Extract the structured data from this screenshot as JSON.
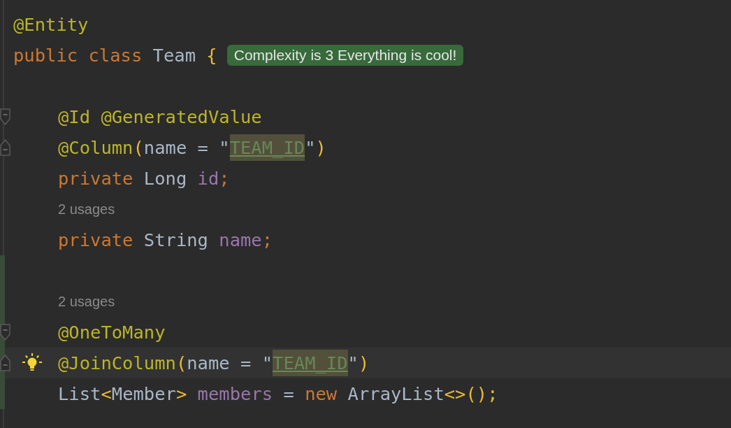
{
  "editor": {
    "lines": [
      {
        "kind": "code",
        "tokens": [
          {
            "kind": "annotation",
            "text": "@Entity"
          }
        ]
      },
      {
        "kind": "code",
        "tokens": [
          {
            "kind": "keyword",
            "text": "public class "
          },
          {
            "kind": "plain",
            "text": "Team "
          },
          {
            "kind": "brace",
            "text": "{"
          }
        ],
        "badge": "Complexity is 3 Everything is cool!",
        "children": [
          {
            "kind": "blank"
          },
          {
            "kind": "code",
            "fold_start": true,
            "tokens": [
              {
                "kind": "annotation",
                "text": "@Id @GeneratedValue"
              }
            ]
          },
          {
            "kind": "code",
            "fold_end": true,
            "tokens": [
              {
                "kind": "annotation",
                "text": "@Column"
              },
              {
                "kind": "brace",
                "text": "("
              },
              {
                "kind": "plain",
                "text": "name = \""
              },
              {
                "kind": "string",
                "text": "TEAM_ID",
                "highlighted": true
              },
              {
                "kind": "plain",
                "text": "\""
              },
              {
                "kind": "brace",
                "text": ")"
              }
            ]
          },
          {
            "kind": "code",
            "tokens": [
              {
                "kind": "keyword",
                "text": "private "
              },
              {
                "kind": "plain",
                "text": "Long "
              },
              {
                "kind": "field",
                "text": "id"
              },
              {
                "kind": "keyword",
                "text": ";"
              }
            ]
          },
          {
            "kind": "hint",
            "text": "2 usages"
          },
          {
            "kind": "code",
            "tokens": [
              {
                "kind": "keyword",
                "text": "private "
              },
              {
                "kind": "plain",
                "text": "String "
              },
              {
                "kind": "field",
                "text": "name"
              },
              {
                "kind": "keyword",
                "text": ";"
              }
            ]
          },
          {
            "kind": "blank",
            "changed": true
          },
          {
            "kind": "hint",
            "text": "2 usages",
            "changed": true
          },
          {
            "kind": "code",
            "fold_start": true,
            "changed": true,
            "tokens": [
              {
                "kind": "annotation",
                "text": "@OneToMany"
              }
            ]
          },
          {
            "kind": "code",
            "fold_end": true,
            "changed": true,
            "current": true,
            "bulb": true,
            "tokens": [
              {
                "kind": "annotation",
                "text": "@JoinColumn"
              },
              {
                "kind": "brace",
                "text": "("
              },
              {
                "kind": "plain",
                "text": "name = \""
              },
              {
                "kind": "string",
                "text": "TEAM_ID",
                "highlighted": true
              },
              {
                "kind": "plain",
                "text": "\""
              },
              {
                "kind": "brace",
                "text": ")"
              }
            ]
          },
          {
            "kind": "code",
            "changed": true,
            "tokens": [
              {
                "kind": "plain",
                "text": "List"
              },
              {
                "kind": "brace",
                "text": "<"
              },
              {
                "kind": "plain",
                "text": "Member"
              },
              {
                "kind": "brace",
                "text": ">"
              },
              {
                "kind": "field",
                "text": " members "
              },
              {
                "kind": "plain",
                "text": "= "
              },
              {
                "kind": "keyword",
                "text": "new "
              },
              {
                "kind": "plain",
                "text": "ArrayList"
              },
              {
                "kind": "brace",
                "text": "<>();"
              }
            ]
          }
        ]
      }
    ]
  }
}
